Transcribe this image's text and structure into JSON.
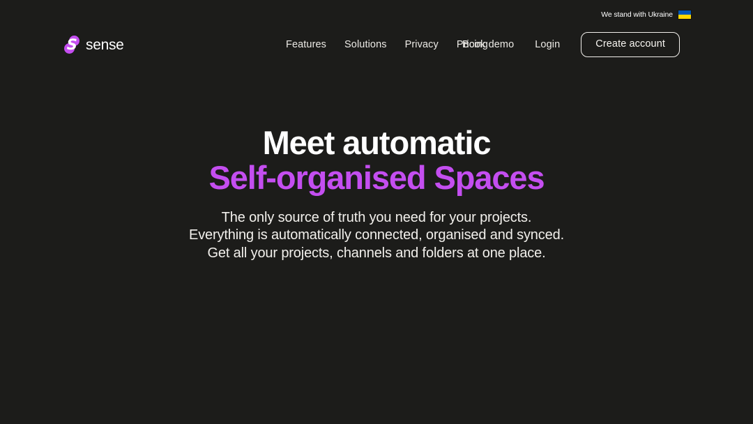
{
  "theme": {
    "background": "#1c1c1a",
    "accent": "#c44ef0",
    "text_primary": "#ffffff",
    "text_secondary": "#eceae6",
    "border": "#f2f0ec"
  },
  "solidarity": {
    "text": "We stand with Ukraine",
    "flag_icon": "ukraine-flag-icon",
    "flag_colors": [
      "#0057b8",
      "#ffd700"
    ]
  },
  "brand": {
    "name": "sense",
    "mark_letter": "S",
    "mark_icon": "sense-logo-icon",
    "mark_color": "#c44ef0"
  },
  "nav": {
    "items": [
      {
        "label": "Features"
      },
      {
        "label": "Solutions"
      },
      {
        "label": "Privacy"
      },
      {
        "label": "Pricing"
      }
    ]
  },
  "actions": {
    "book_demo": "Book demo",
    "login": "Login",
    "create_account": "Create account"
  },
  "hero": {
    "title_line_1": "Meet automatic",
    "title_line_2": "Self-organised Spaces",
    "subtitle_line_1": "The only source of truth you need for your projects.",
    "subtitle_line_2": "Everything is automatically connected, organised and synced.",
    "subtitle_line_3": "Get all your projects, channels and folders at one place."
  }
}
